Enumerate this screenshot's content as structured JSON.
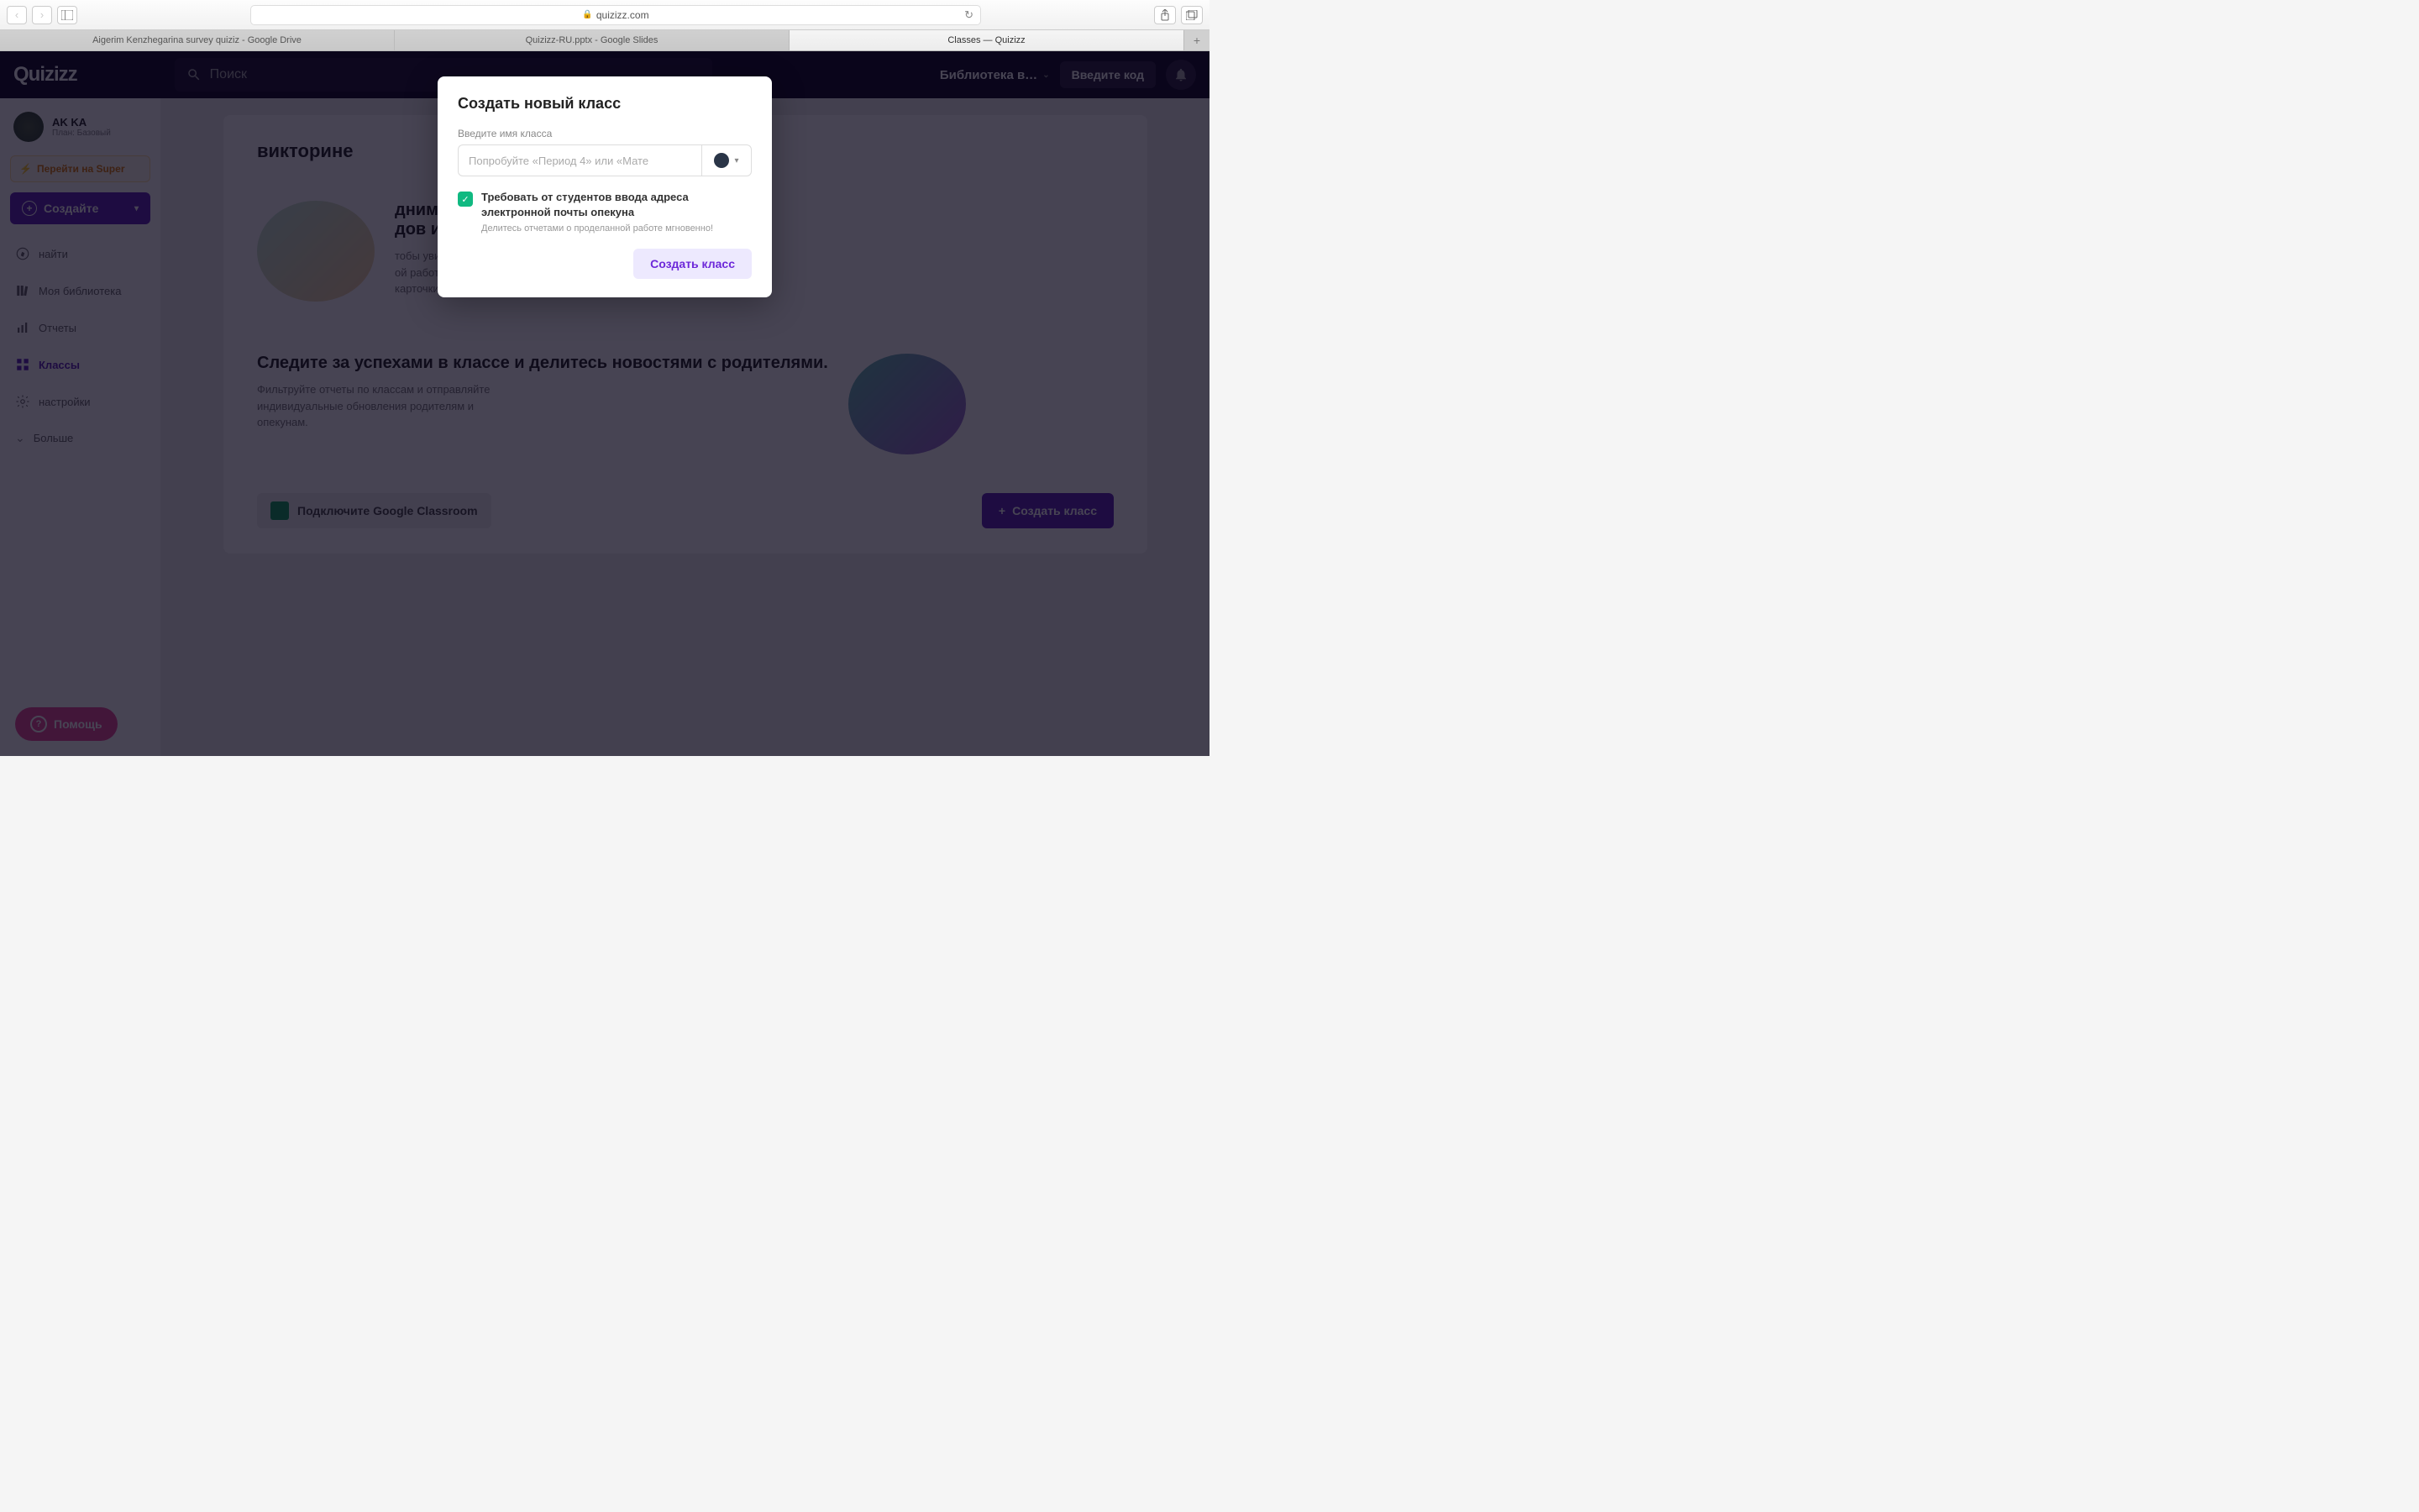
{
  "browser": {
    "url": "quizizz.com",
    "tabs": [
      "Aigerim Kenzhegarina survey quiziz - Google Drive",
      "Quizizz-RU.pptx - Google Slides",
      "Classes — Quizizz"
    ]
  },
  "header": {
    "logo": "Quizizz",
    "search_placeholder": "Поиск",
    "library": "Библиотека в…",
    "enter_code": "Введите код"
  },
  "sidebar": {
    "profile_name": "AK KA",
    "profile_plan": "План: Базовый",
    "super": "Перейти на Super",
    "create": "Создайте",
    "items": {
      "find": "найти",
      "library": "Моя библиотека",
      "reports": "Отчеты",
      "classes": "Классы",
      "settings": "настройки",
      "more": "Больше"
    }
  },
  "main": {
    "heading_suffix": "викторине",
    "feature1_title": "дним кликом\nдов игр!",
    "feature1_desc": "тобы увидеть\nой работе,\nкарточки и многое другое.",
    "feature2_title": "Следите за успехами в классе и делитесь новостями с родителями.",
    "feature2_desc": "Фильтруйте отчеты по классам и отправляйте индивидуальные обновления родителям и опекунам.",
    "connect_gc": "Подключите Google Classroom",
    "create_class": "Создать класс"
  },
  "modal": {
    "title": "Создать новый класс",
    "label": "Введите имя класса",
    "placeholder": "Попробуйте «Период 4» или «Мате",
    "checkbox_label": "Требовать от студентов ввода адреса электронной почты опекуна",
    "checkbox_sub": "Делитесь отчетами о проделанной работе мгновенно!",
    "submit": "Создать класс"
  },
  "help": "Помощь"
}
